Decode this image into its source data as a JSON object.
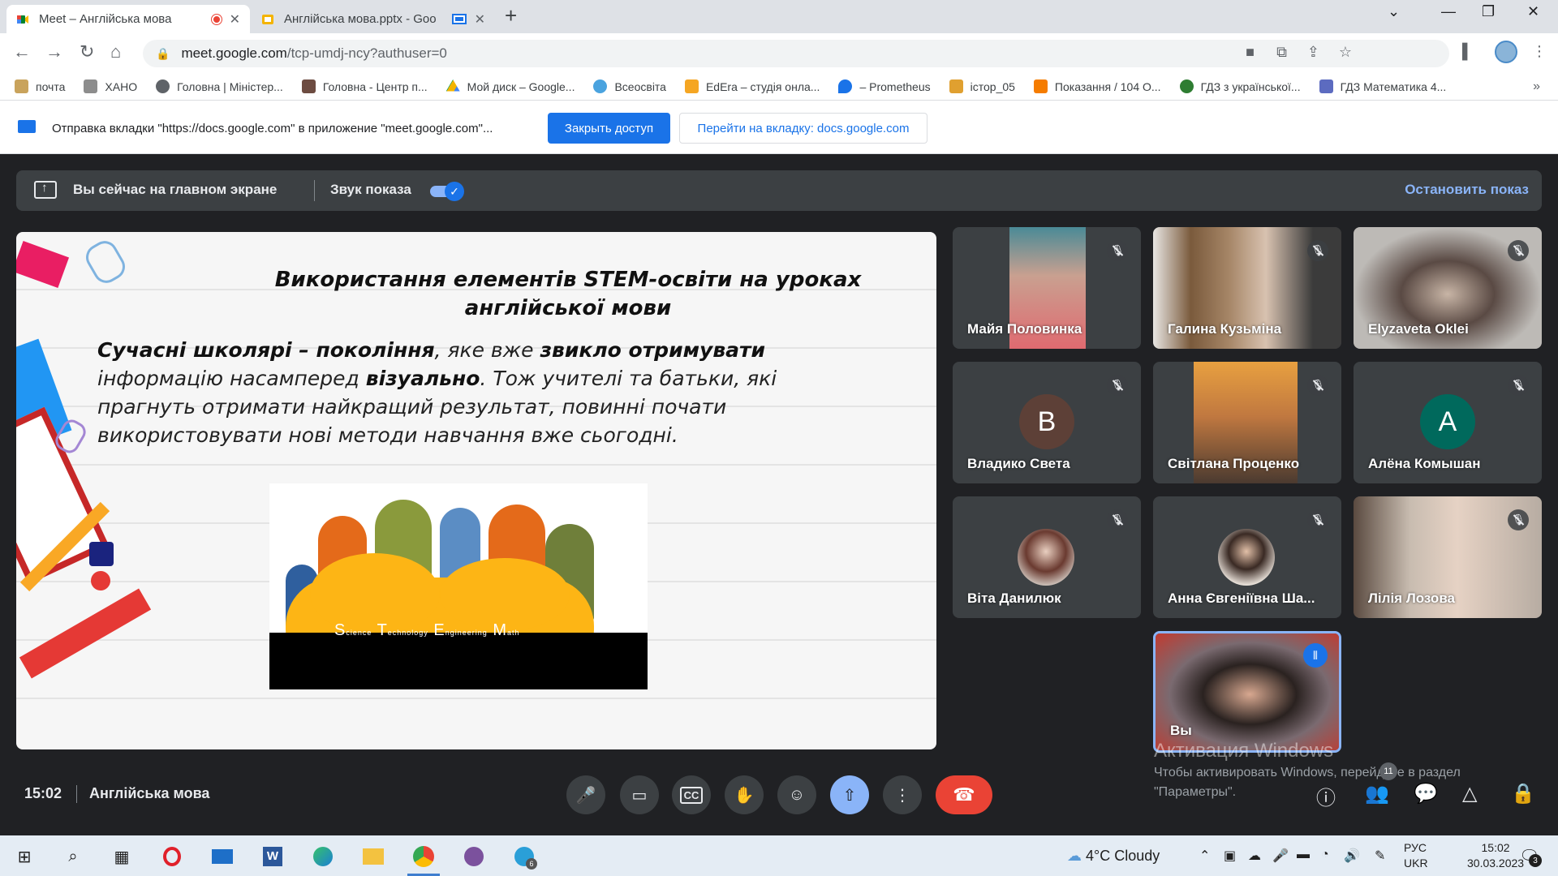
{
  "tabs": [
    {
      "title": "Meet – Англійська мова",
      "active": true
    },
    {
      "title": "Англійська мова.pptx - Goo",
      "active": false
    }
  ],
  "address": {
    "host": "meet.google.com",
    "path": "/tcp-umdj-ncy?authuser=0"
  },
  "bookmarks": [
    {
      "label": "почта",
      "icon": "mail-icon"
    },
    {
      "label": "ХАНО",
      "icon": "car-icon"
    },
    {
      "label": "Головна | Міністер...",
      "icon": "globe-icon"
    },
    {
      "label": "Головна - Центр п...",
      "icon": "puzzle-icon"
    },
    {
      "label": "Мой диск – Google...",
      "icon": "drive-icon"
    },
    {
      "label": "Всеосвіта",
      "icon": "snowflake-icon"
    },
    {
      "label": "EdEra – студія онла...",
      "icon": "pencil-icon"
    },
    {
      "label": "– Prometheus",
      "icon": "pin-icon"
    },
    {
      "label": "істор_05",
      "icon": "screen-icon"
    },
    {
      "label": "Показання / 104 О...",
      "icon": "meter-icon"
    },
    {
      "label": "ГДЗ з української...",
      "icon": "gdz-icon"
    },
    {
      "label": "ГДЗ Математика 4...",
      "icon": "shield-icon"
    }
  ],
  "infobar": {
    "message": "Отправка вкладки \"https://docs.google.com\" в приложение \"meet.google.com\"...",
    "close_access": "Закрыть доступ",
    "goto_tab": "Перейти на вкладку: docs.google.com"
  },
  "present_bar": {
    "status": "Вы сейчас на главном экране",
    "sound": "Звук показа",
    "stop": "Остановить показ"
  },
  "slide": {
    "title": "Використання елементів STEM-освіти на уроках англійської мови",
    "body_parts": [
      {
        "text": "Сучасні школярі – покоління",
        "bold": true
      },
      {
        "text": ", яке вже ",
        "bold": false
      },
      {
        "text": "звикло отримувати",
        "bold": true
      },
      {
        "text": " інформацію насамперед ",
        "bold": false
      },
      {
        "text": "візуально",
        "bold": true
      },
      {
        "text": ". Тож учителі та батьки, які прагнуть отримати найкращий результат, повинні почати використовувати нові методи навчання вже сьогодні.",
        "bold": false
      }
    ],
    "stem_letters": [
      {
        "cap": "S",
        "rest": "cience"
      },
      {
        "cap": "T",
        "rest": "echnology"
      },
      {
        "cap": "E",
        "rest": "ngineering"
      },
      {
        "cap": "M",
        "rest": "ath"
      }
    ]
  },
  "participants": [
    {
      "name": "Майя Половинка",
      "type": "video",
      "muted": true
    },
    {
      "name": "Галина Кузьміна",
      "type": "video",
      "muted": true
    },
    {
      "name": "Elyzaveta Oklei",
      "type": "video",
      "muted": true
    },
    {
      "name": "Владико Света",
      "type": "letter",
      "letter": "В",
      "color": "#5d4037",
      "muted": true
    },
    {
      "name": "Світлана Проценко",
      "type": "video",
      "muted": true
    },
    {
      "name": "Алёна Комышан",
      "type": "letter",
      "letter": "А",
      "color": "#00695c",
      "muted": true
    },
    {
      "name": "Віта Данилюк",
      "type": "photo",
      "muted": true
    },
    {
      "name": "Анна Євгеніївна Ша...",
      "type": "photo",
      "muted": true
    },
    {
      "name": "Лілія Лозова",
      "type": "video",
      "muted": true
    },
    {
      "name": "Вы",
      "type": "self",
      "muted": false
    }
  ],
  "activation": {
    "big": "Активация Windows",
    "line1": "Чтобы активировать Windows, перейдите в раздел",
    "line2": "\"Параметры\"."
  },
  "meeting": {
    "time": "15:02",
    "name": "Англійська мова",
    "people_count": "11"
  },
  "taskbar": {
    "weather": "4°C  Cloudy",
    "lang1": "РУС",
    "lang2": "UKR",
    "time": "15:02",
    "date": "30.03.2023",
    "notifications": "3",
    "telegram_badge": "6"
  },
  "colors": {
    "meet_bg": "#202124",
    "accent": "#8ab4f8",
    "hangup": "#ea4335",
    "primary": "#1a73e8"
  }
}
